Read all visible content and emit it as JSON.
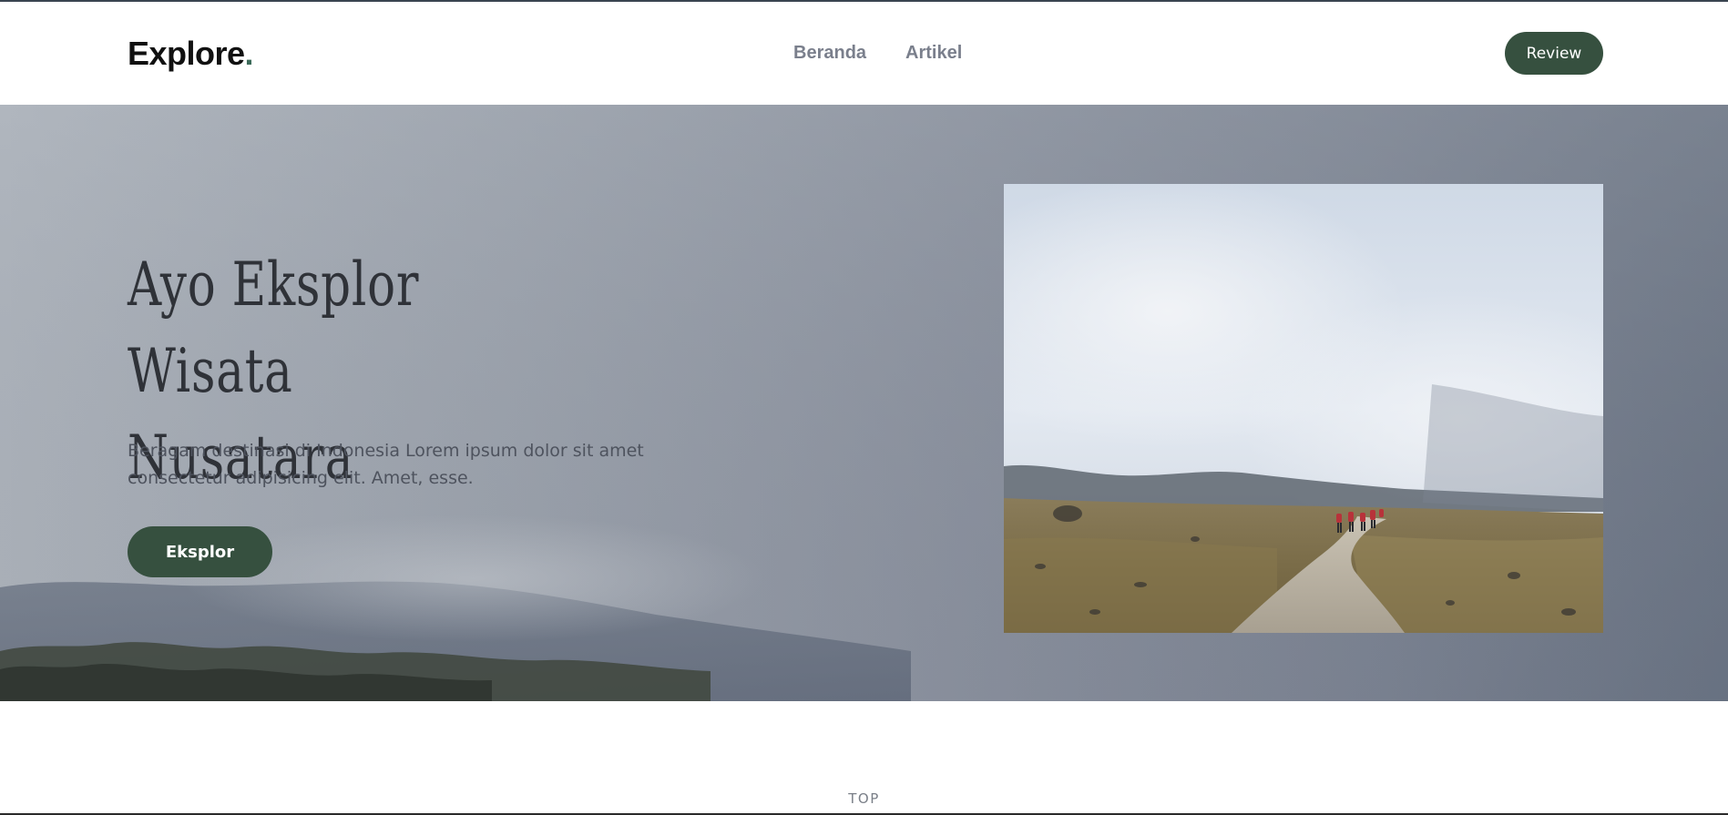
{
  "navbar": {
    "brand_text": "Explore",
    "brand_dot": ".",
    "links": [
      {
        "label": "Beranda"
      },
      {
        "label": "Artikel"
      }
    ],
    "review_label": "Review"
  },
  "hero": {
    "title": "Ayo Eksplor Wisata Nusatara",
    "description": "Beragam destinasi di Indonesia Lorem ipsum dolor sit amet consectetur adipisicing elit. Amet, esse.",
    "button_label": "Eksplor"
  },
  "footer": {
    "top_label": "TOP"
  },
  "colors": {
    "accent": "#36503f",
    "brand_dot": "#3d6b5a",
    "nav_text": "#7a7f8c",
    "title_text": "#2f3238"
  }
}
